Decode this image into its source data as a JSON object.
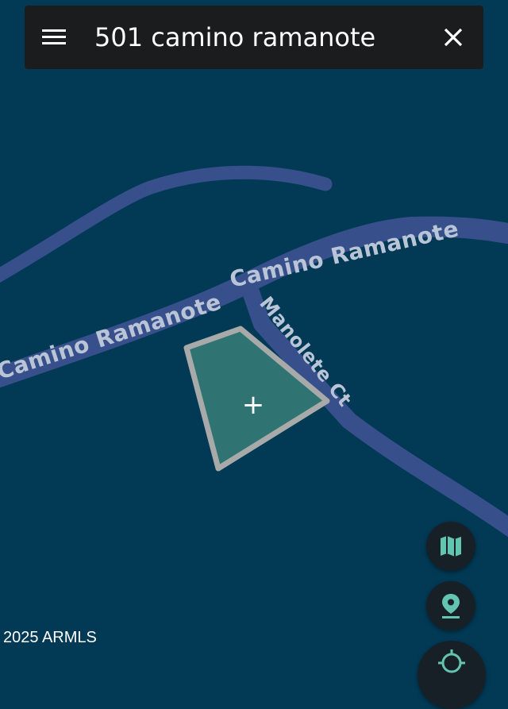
{
  "search": {
    "query": "501 camino ramanote"
  },
  "map": {
    "roads": [
      {
        "name": "Camino Ramanote"
      },
      {
        "name": "Camino Ramanote"
      },
      {
        "name": "Manolete Ct"
      }
    ],
    "parcel_marker": "+",
    "copyright": "2025 ARMLS"
  },
  "colors": {
    "water_background": "#023a56",
    "road": "#37508c",
    "parcel_fill": "#2f7372",
    "parcel_outline": "#a7aaa9",
    "accent": "#64c4b2"
  },
  "icons": {
    "menu": "hamburger-icon",
    "close": "close-icon",
    "map_layers": "map-icon",
    "pin": "location-pin-icon",
    "locate": "my-location-icon"
  }
}
